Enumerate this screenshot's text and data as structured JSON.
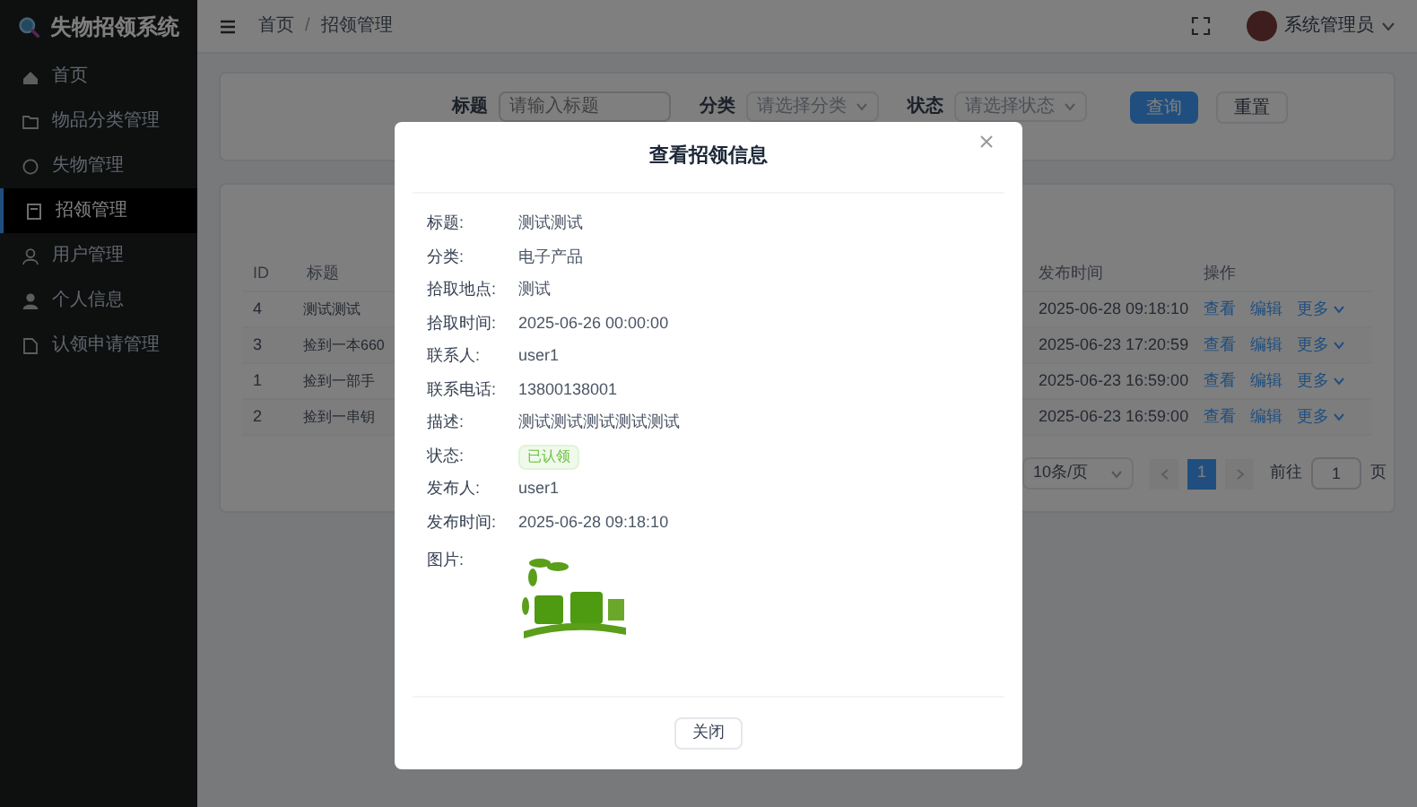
{
  "sidebar": {
    "title": "失物招领系统",
    "items": [
      {
        "label": "首页",
        "selected": false
      },
      {
        "label": "物品分类管理",
        "selected": false
      },
      {
        "label": "失物管理",
        "selected": false
      },
      {
        "label": "招领管理",
        "selected": true
      },
      {
        "label": "用户管理",
        "selected": false
      },
      {
        "label": "个人信息",
        "selected": false
      },
      {
        "label": "认领申请管理",
        "selected": false
      }
    ]
  },
  "header": {
    "breadcrumbs": [
      "首页",
      "招领管理"
    ],
    "separator": "/",
    "user": "系统管理员"
  },
  "filters": {
    "fields": [
      {
        "label": "标题",
        "placeholder": "请输入标题",
        "kind": "input"
      },
      {
        "label": "分类",
        "placeholder": "请选择分类",
        "kind": "select"
      },
      {
        "label": "状态",
        "placeholder": "请选择状态",
        "kind": "select"
      }
    ],
    "buttons": [
      {
        "label": "查询",
        "kind": "primary"
      },
      {
        "label": "重置",
        "kind": "default"
      }
    ]
  },
  "table": {
    "columns": [
      "ID",
      "标题",
      "发布时间",
      "操作"
    ],
    "rows": [
      {
        "id": "4",
        "title": "测试测试",
        "published": "2025-06-28 09:18:10",
        "actions": [
          "查看",
          "编辑",
          "更多"
        ]
      },
      {
        "id": "3",
        "title": "捡到一本660",
        "published": "2025-06-23 17:20:59",
        "actions": [
          "查看",
          "编辑",
          "更多"
        ]
      },
      {
        "id": "1",
        "title": "捡到一部手",
        "published": "2025-06-23 16:59:00",
        "actions": [
          "查看",
          "编辑",
          "更多"
        ]
      },
      {
        "id": "2",
        "title": "捡到一串钥",
        "published": "2025-06-23 16:59:00",
        "actions": [
          "查看",
          "编辑",
          "更多"
        ]
      }
    ]
  },
  "pagination": {
    "page_size": "10条/页",
    "pages": [
      {
        "label": "1",
        "selected": true
      }
    ],
    "goto_label": "前往",
    "goto_value": "1",
    "goto_suffix": "页"
  },
  "dialog": {
    "title": "查看招领信息",
    "fields": [
      {
        "label": "标题:",
        "value": "测试测试",
        "kind": "text"
      },
      {
        "label": "分类:",
        "value": "电子产品",
        "kind": "text"
      },
      {
        "label": "拾取地点:",
        "value": "测试",
        "kind": "text"
      },
      {
        "label": "拾取时间:",
        "value": "2025-06-26 00:00:00",
        "kind": "text"
      },
      {
        "label": "联系人:",
        "value": "user1",
        "kind": "text"
      },
      {
        "label": "联系电话:",
        "value": "13800138001",
        "kind": "text"
      },
      {
        "label": "描述:",
        "value": "测试测试测试测试测试",
        "kind": "text"
      },
      {
        "label": "状态:",
        "value": "已认领",
        "kind": "tag"
      },
      {
        "label": "发布人:",
        "value": "user1",
        "kind": "text"
      },
      {
        "label": "发布时间:",
        "value": "2025-06-28 09:18:10",
        "kind": "text"
      },
      {
        "label": "图片:",
        "kind": "picture"
      }
    ],
    "close_button": "关闭"
  }
}
